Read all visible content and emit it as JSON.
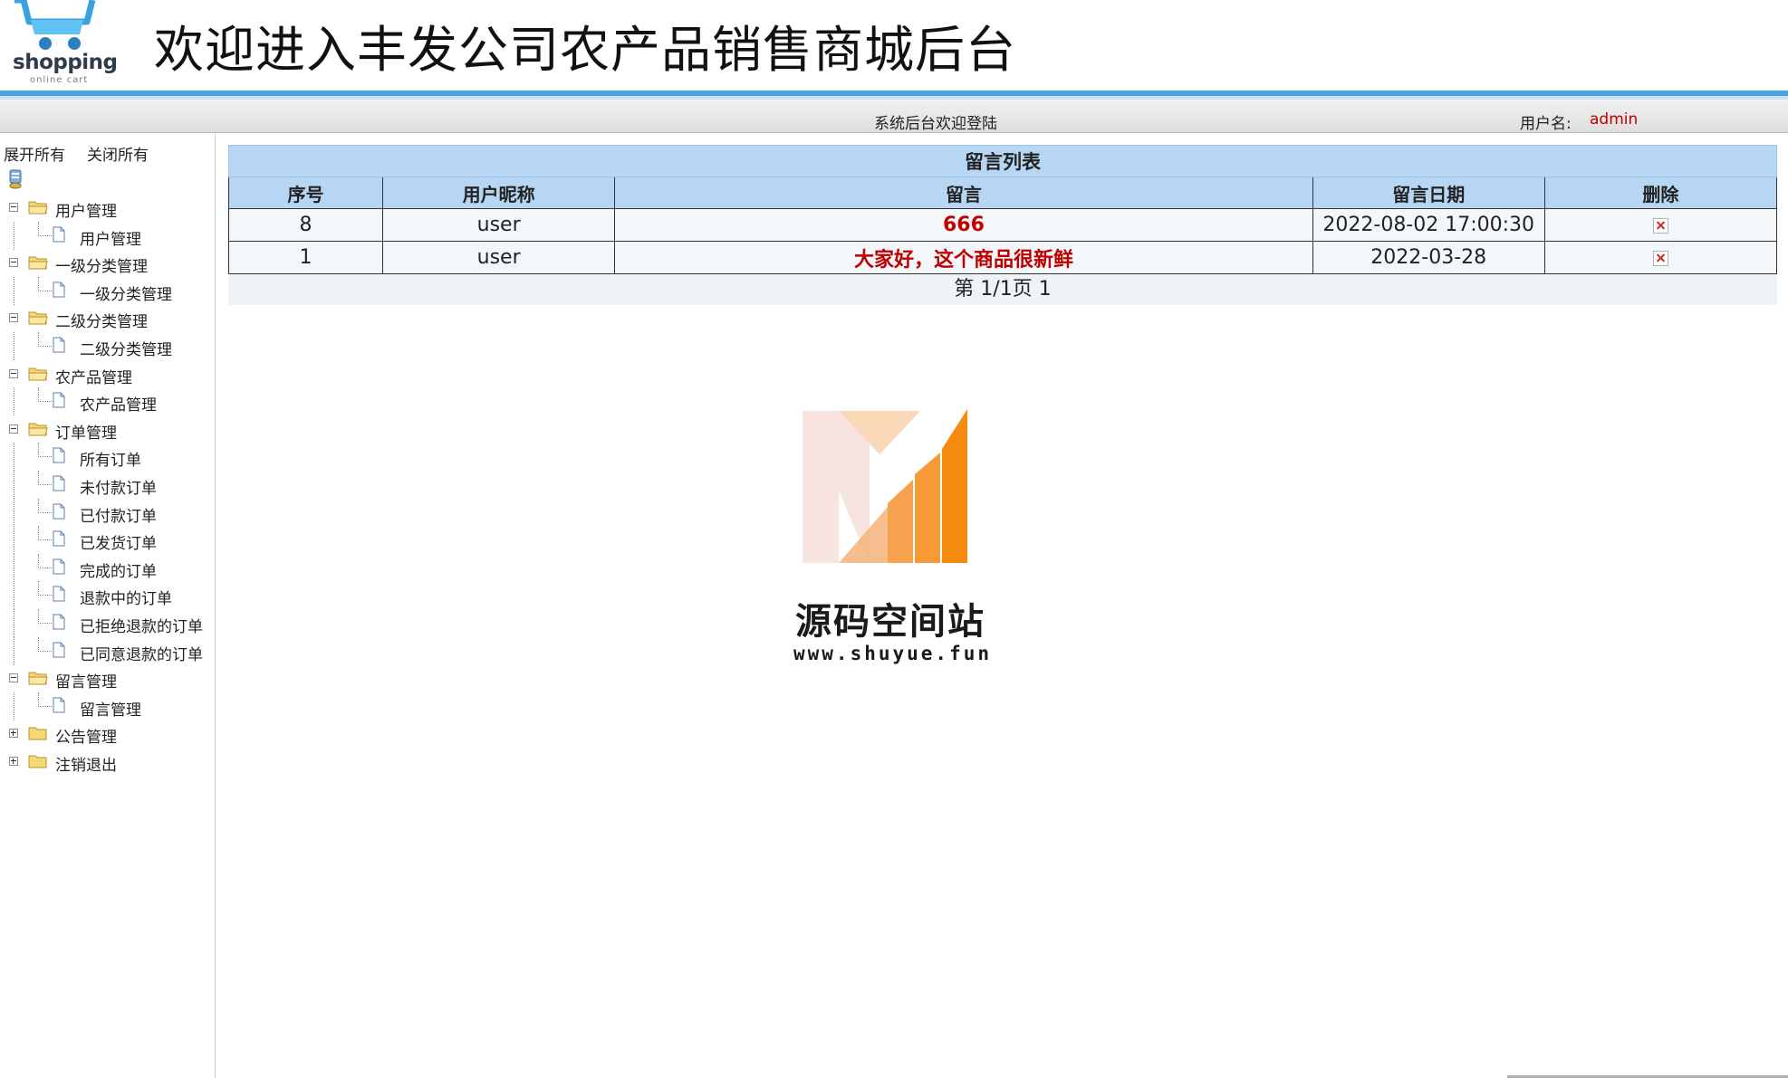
{
  "header": {
    "logo_word": "shopping",
    "logo_sub": "online cart",
    "title": "欢迎进入丰发公司农产品销售商城后台"
  },
  "statusbar": {
    "welcome": "系统后台欢迎登陆",
    "user_label": "用户名:",
    "user_name": "admin"
  },
  "sidebar": {
    "expand_all": "展开所有",
    "collapse_all": "关闭所有",
    "tree": [
      {
        "label": "用户管理",
        "expanded": true,
        "children": [
          "用户管理"
        ]
      },
      {
        "label": "一级分类管理",
        "expanded": true,
        "children": [
          "一级分类管理"
        ]
      },
      {
        "label": "二级分类管理",
        "expanded": true,
        "children": [
          "二级分类管理"
        ]
      },
      {
        "label": "农产品管理",
        "expanded": true,
        "children": [
          "农产品管理"
        ]
      },
      {
        "label": "订单管理",
        "expanded": true,
        "children": [
          "所有订单",
          "未付款订单",
          "已付款订单",
          "已发货订单",
          "完成的订单",
          "退款中的订单",
          "已拒绝退款的订单",
          "已同意退款的订单"
        ]
      },
      {
        "label": "留言管理",
        "expanded": true,
        "children": [
          "留言管理"
        ]
      },
      {
        "label": "公告管理",
        "expanded": false,
        "children": []
      },
      {
        "label": "注销退出",
        "expanded": false,
        "children": []
      }
    ]
  },
  "table": {
    "title": "留言列表",
    "columns": [
      "序号",
      "用户昵称",
      "留言",
      "留言日期",
      "删除"
    ],
    "rows": [
      {
        "id": "8",
        "nickname": "user",
        "message": "666",
        "date": "2022-08-02 17:00:30"
      },
      {
        "id": "1",
        "nickname": "user",
        "message": "大家好，这个商品很新鲜",
        "date": "2022-03-28"
      }
    ],
    "pager": "第 1/1页 1"
  },
  "watermark": {
    "name": "源码空间站",
    "url": "www.shuyue.fun"
  },
  "colors": {
    "accent_blue": "#4aa3df",
    "table_header": "#b7d6f3",
    "alert_red": "#c00000"
  }
}
